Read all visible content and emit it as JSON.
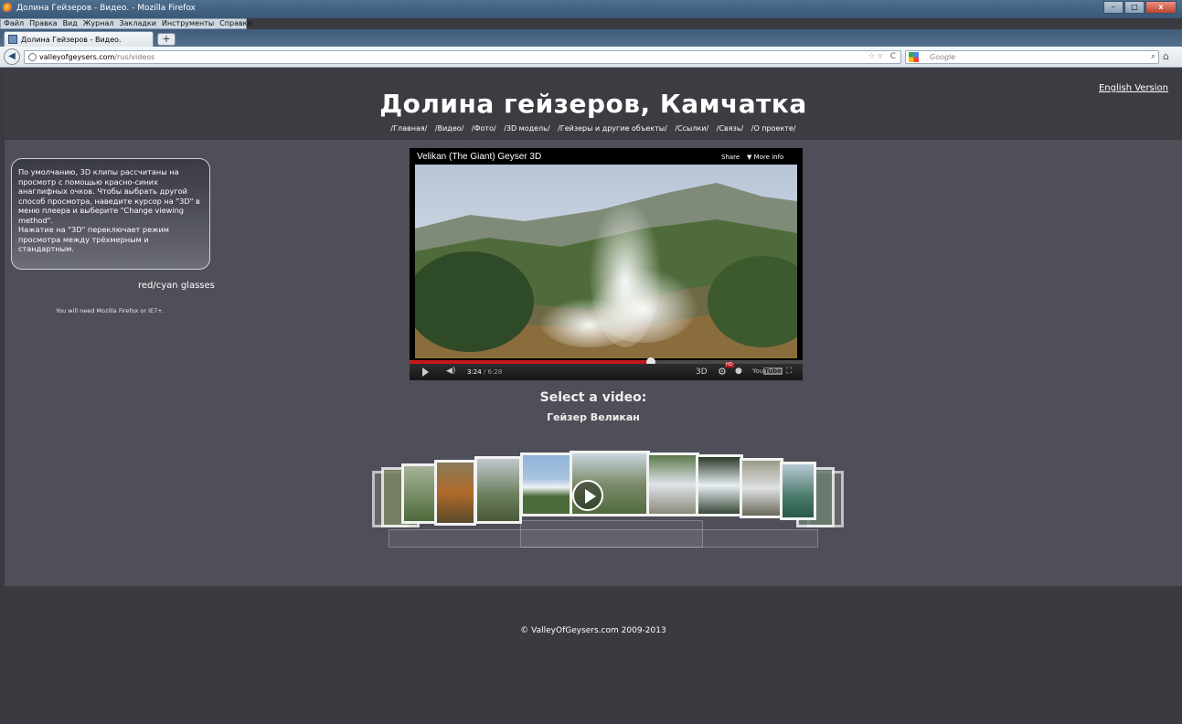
{
  "window": {
    "title": "Долина Гейзеров - Видео. - Mozilla Firefox",
    "controls": [
      "–",
      "□",
      "x"
    ]
  },
  "menu": [
    "Файл",
    "Правка",
    "Вид",
    "Журнал",
    "Закладки",
    "Инструменты",
    "Справка"
  ],
  "tab": {
    "label": "Долина Гейзеров - Видео.",
    "new_tab": "+"
  },
  "nav": {
    "back": "◀",
    "url_host": "valleyofgeysers.com",
    "url_path": "/rus/videos",
    "star": "☆ ▿",
    "reload": "C",
    "search_placeholder": "Google",
    "search_icon": "⌕",
    "home": "⌂"
  },
  "site": {
    "title": "Долина гейзеров, Камчатка",
    "english_link": "English Version",
    "menu": [
      "/Главная/",
      "/Видео/",
      "/Фото/",
      "/3D модель/",
      "/Гейзеры и другие объекты/",
      "/Ссылки/",
      "/Связь/",
      "/О проекте/"
    ]
  },
  "sidebar": {
    "info": "По умолчанию, 3D клипы рассчитаны на просмотр с помощью красно-синих анаглифных очков. Чтобы выбрать другой способ просмотра, наведите курсор на \"3D\" в меню плеера и выберите \"Change viewing method\".",
    "info2": "Нажатие на \"3D\" переключает режим просмотра между трёхмерным и стандартным.",
    "glasses": "red/cyan glasses",
    "requirement": "You will need Mozilla Firefox or IE7+."
  },
  "player": {
    "title": "Velikan (The Giant) Geyser 3D",
    "share": "Share",
    "more_info": "More info",
    "time_current": "3:24",
    "time_total": "/ 6:28",
    "progress": 0.615,
    "btn_3d": "3D",
    "hd": "HD",
    "youtube": "You",
    "youtube_box": "Tube"
  },
  "gallery": {
    "heading": "Select a video:",
    "current": "Гейзер Великан"
  },
  "footer": {
    "copyright": "© ValleyOfGeysers.com 2009-2013"
  },
  "colors": {
    "page_bg": "#4e4f58",
    "header_bg": "#3c3d42",
    "accent_red": "#c3181d"
  }
}
